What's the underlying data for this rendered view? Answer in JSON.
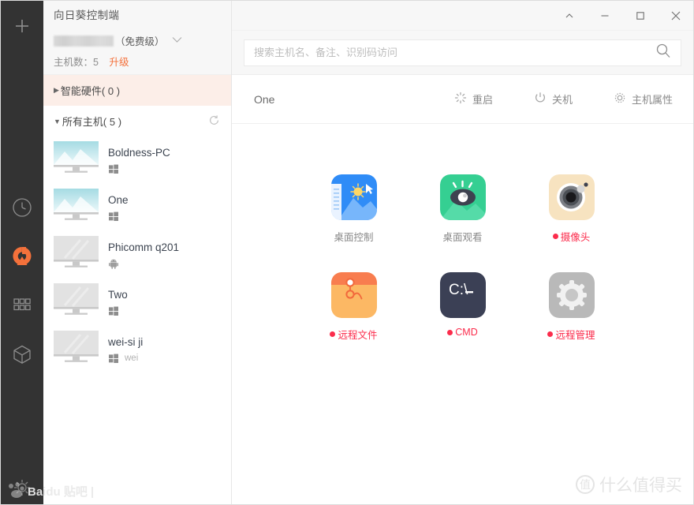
{
  "window": {
    "app_title": "向日葵控制端",
    "controls": [
      {
        "name": "collapse",
        "glyph": "⌃"
      },
      {
        "name": "minimize",
        "glyph": "—"
      },
      {
        "name": "maximize",
        "glyph": "◻"
      },
      {
        "name": "close",
        "glyph": "✕"
      }
    ]
  },
  "rail": {
    "add_label": "+",
    "items": [
      {
        "name": "history",
        "icon": "clock-icon"
      },
      {
        "name": "sunlogin",
        "icon": "sunflower-logo-icon",
        "color": "#f4713b"
      },
      {
        "name": "apps",
        "icon": "grid-icon"
      },
      {
        "name": "plugins",
        "icon": "cube-icon"
      }
    ]
  },
  "account": {
    "username_masked": "",
    "level": "（免费级）",
    "hosts_label": "主机数：5",
    "upgrade": "升级",
    "upgrade_color": "#f4713b"
  },
  "groups": [
    {
      "name": "smart-hardware",
      "arrow": "▶",
      "label": "智能硬件( 0 )",
      "selected": true
    },
    {
      "name": "all-hosts",
      "arrow": "▼",
      "label": "所有主机( 5 )",
      "selected": false
    }
  ],
  "hosts": [
    {
      "name": "Boldness-PC",
      "os": "windows",
      "note": "",
      "online": true
    },
    {
      "name": "One",
      "os": "windows",
      "note": "",
      "online": true
    },
    {
      "name": "Phicomm q201",
      "os": "android",
      "note": "",
      "online": false
    },
    {
      "name": "Two",
      "os": "windows",
      "note": "",
      "online": false
    },
    {
      "name": "wei-si ji",
      "os": "windows",
      "note": "wei",
      "online": false
    }
  ],
  "search": {
    "value": "",
    "placeholder": "搜索主机名、备注、识别码访问"
  },
  "content": {
    "current_host": "One",
    "actions": [
      {
        "name": "restart",
        "icon": "restart-icon",
        "label": "重启"
      },
      {
        "name": "shutdown",
        "icon": "power-icon",
        "label": "关机"
      },
      {
        "name": "host-properties",
        "icon": "gear-icon",
        "label": "主机属性"
      }
    ],
    "apps": [
      [
        {
          "name": "desktop-control",
          "label": "桌面控制",
          "marked": false
        },
        {
          "name": "desktop-view",
          "label": "桌面观看",
          "marked": false
        },
        {
          "name": "camera",
          "label": "摄像头",
          "marked": true
        }
      ],
      [
        {
          "name": "remote-file",
          "label": "远程文件",
          "marked": true
        },
        {
          "name": "cmd",
          "label": "CMD",
          "marked": true
        },
        {
          "name": "remote-manage",
          "label": "远程管理",
          "marked": true
        }
      ]
    ]
  },
  "watermarks": {
    "baidu": "Baidu 贴吧 |",
    "smzdm_mark": "值",
    "smzdm": "什么值得买"
  },
  "colors": {
    "accent": "#f4713b",
    "rail_bg": "#333333",
    "group_selected_bg": "#fceee8",
    "badge_red": "#fb2c4c"
  }
}
